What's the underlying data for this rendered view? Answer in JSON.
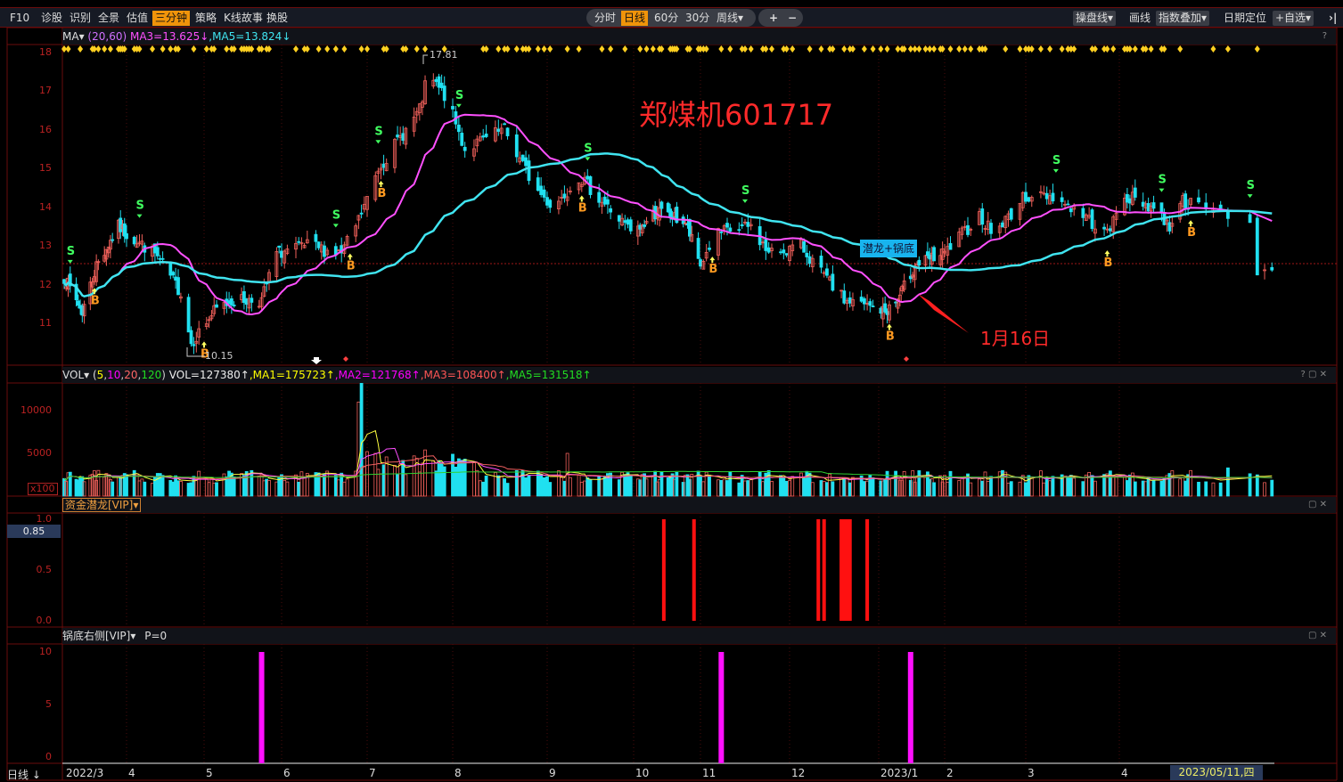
{
  "toolbar": {
    "left": [
      "F10",
      "诊股",
      "识别",
      "全景",
      "估值",
      "三分钟",
      "策略",
      "K线故事",
      "换股"
    ],
    "active_left": "三分钟",
    "periods": [
      "分时",
      "日线",
      "60分",
      "30分",
      "周线▾"
    ],
    "active_period": "日线",
    "zoom_in": "+",
    "zoom_out": "−",
    "right": [
      "操盘线▾",
      "画线",
      "指数叠加▾",
      "日期定位",
      "+自选▾"
    ],
    "collapse": "›|"
  },
  "main_chart": {
    "indicator": "MA▾",
    "params": "(20,60)",
    "ma3": "MA3=13.625↓",
    "ma5": ",MA5=13.824↓",
    "title_annotation": "郑煤机601717",
    "date_annotation": "1月16日",
    "signal_label": "潜龙+锅底",
    "high_label": "17.81",
    "low_label": "10.15",
    "help": "?",
    "y_ticks": [
      "18",
      "17",
      "16",
      "15",
      "14",
      "13",
      "12",
      "11"
    ],
    "colors": {
      "up": "#f0605a",
      "down": "#20e0f0",
      "ma20": "#ff50ff",
      "ma60": "#40e4f0",
      "annotation": "#ff2a2a"
    }
  },
  "volume": {
    "indicator": "VOL▾",
    "params_open": "(",
    "p5": "5",
    ",1": ",",
    "p10": "10",
    "p20": "20",
    "p120": "120",
    "params_close": ")",
    "vol": "VOL=127380↑",
    "ma1": ",MA1=175723↑",
    "ma2": ",MA2=121768↑",
    "ma3": ",MA3=108400↑",
    "ma5": ",MA5=131518↑",
    "y_ticks": [
      "10000",
      "5000"
    ],
    "unit": "x100",
    "controls": "? ▢ ✕"
  },
  "zjql": {
    "indicator": "资金潜龙[VIP]▾",
    "y_ticks": [
      "1.0",
      "0.5",
      "0.0"
    ],
    "current": "0.85",
    "controls": "▢ ✕"
  },
  "gdyc": {
    "indicator": "锅底右侧[VIP]▾",
    "param": "P=0",
    "y_ticks": [
      "10",
      "5",
      "0"
    ],
    "controls": "▢ ✕"
  },
  "time_axis": {
    "period": "日线 ↓",
    "months": [
      "2022/3",
      "4",
      "5",
      "6",
      "7",
      "8",
      "9",
      "10",
      "11",
      "12",
      "2023/1",
      "2",
      "3",
      "4"
    ],
    "cursor_date": "2023/05/11,四"
  },
  "chart_data": {
    "type": "candlestick",
    "symbol": "601717",
    "range": [
      "2022-03-01",
      "2023-05-11"
    ],
    "ylim": [
      10,
      18.3
    ],
    "close_path": [
      [
        "2022-03-01",
        12.2
      ],
      [
        "2022-03-10",
        11.3
      ],
      [
        "2022-03-17",
        12.5
      ],
      [
        "2022-03-28",
        13.5
      ],
      [
        "2022-04-12",
        12.8
      ],
      [
        "2022-04-22",
        11.8
      ],
      [
        "2022-04-26",
        10.5
      ],
      [
        "2022-05-05",
        11.3
      ],
      [
        "2022-05-12",
        11.6
      ],
      [
        "2022-05-24",
        11.6
      ],
      [
        "2022-05-30",
        12.8
      ],
      [
        "2022-06-10",
        13.0
      ],
      [
        "2022-06-22",
        12.8
      ],
      [
        "2022-06-27",
        13.5
      ],
      [
        "2022-07-01",
        14.2
      ],
      [
        "2022-07-05",
        15.0
      ],
      [
        "2022-07-10",
        15.5
      ],
      [
        "2022-07-20",
        16.5
      ],
      [
        "2022-07-23",
        17.4
      ],
      [
        "2022-07-30",
        16.8
      ],
      [
        "2022-08-05",
        15.5
      ],
      [
        "2022-08-18",
        16.0
      ],
      [
        "2022-08-28",
        14.5
      ],
      [
        "2022-09-03",
        14.0
      ],
      [
        "2022-09-12",
        14.8
      ],
      [
        "2022-09-22",
        14.0
      ],
      [
        "2022-10-01",
        13.3
      ],
      [
        "2022-10-12",
        13.9
      ],
      [
        "2022-10-25",
        13.6
      ],
      [
        "2022-11-01",
        12.5
      ],
      [
        "2022-11-06",
        13.3
      ],
      [
        "2022-11-18",
        13.5
      ],
      [
        "2022-11-24",
        12.8
      ],
      [
        "2022-12-05",
        13.0
      ],
      [
        "2022-12-12",
        12.3
      ],
      [
        "2022-12-20",
        11.6
      ],
      [
        "2023-01-04",
        11.3
      ],
      [
        "2023-01-10",
        11.6
      ],
      [
        "2023-01-18",
        12.5
      ],
      [
        "2023-02-01",
        12.8
      ],
      [
        "2023-02-13",
        13.8
      ],
      [
        "2023-02-18",
        13.3
      ],
      [
        "2023-03-01",
        14.3
      ],
      [
        "2023-03-10",
        14.3
      ],
      [
        "2023-03-20",
        13.8
      ],
      [
        "2023-03-28",
        13.3
      ],
      [
        "2023-04-03",
        14.3
      ],
      [
        "2023-04-14",
        14.0
      ],
      [
        "2023-04-20",
        13.5
      ],
      [
        "2023-04-24",
        14.2
      ],
      [
        "2023-05-04",
        13.9
      ],
      [
        "2023-05-08",
        13.6
      ],
      [
        "2023-05-09",
        12.4
      ],
      [
        "2023-05-11",
        12.3
      ]
    ],
    "buy_signals": [
      "2022-03-16",
      "2022-05-01",
      "2022-06-25",
      "2022-07-06",
      "2022-09-13",
      "2022-11-05",
      "2023-01-06",
      "2023-03-28",
      "2023-04-28"
    ],
    "sell_signals": [
      "2022-03-04",
      "2022-04-06",
      "2022-06-20",
      "2022-07-05",
      "2022-08-03",
      "2022-09-15",
      "2022-11-16",
      "2023-03-11",
      "2023-04-17",
      "2023-05-08"
    ],
    "volume_spikes": [
      [
        "2022-06-28",
        11000
      ],
      [
        "2022-06-29",
        13500
      ],
      [
        "2022-07-01",
        5200
      ],
      [
        "2022-07-04",
        5000
      ],
      [
        "2022-07-22",
        5400
      ],
      [
        "2022-08-01",
        4900
      ],
      [
        "2022-09-08",
        5000
      ],
      [
        "2023-05-05",
        3300
      ]
    ],
    "zjql_bars": [
      "2022-10-15",
      "2022-10-29",
      "2022-12-11",
      "2022-12-13",
      "2022-12-19",
      "2022-12-20",
      "2022-12-21",
      "2022-12-22",
      "2022-12-28"
    ],
    "gdyc_spikes": [
      [
        "2022-05-24",
        10
      ],
      [
        "2022-11-08",
        10
      ],
      [
        "2023-01-16",
        10
      ]
    ]
  }
}
